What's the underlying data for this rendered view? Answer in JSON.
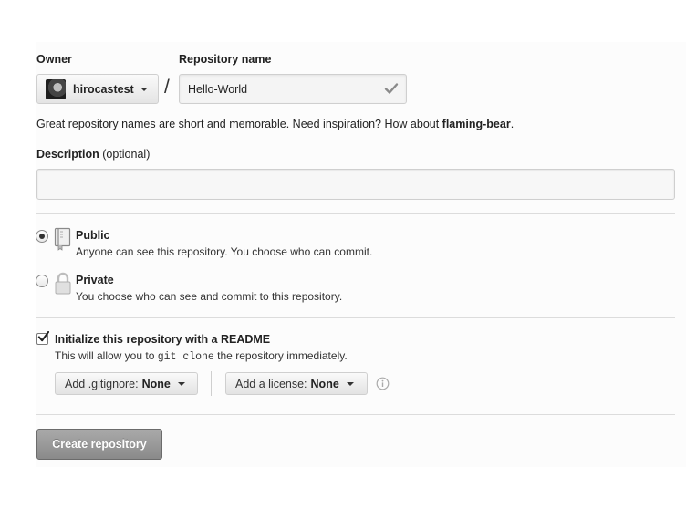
{
  "owner": {
    "label": "Owner",
    "name": "hirocastest"
  },
  "repository": {
    "label": "Repository name",
    "value": "Hello-World",
    "separator": "/"
  },
  "hint": {
    "text": "Great repository names are short and memorable. Need inspiration? How about ",
    "suggestion": "flaming-bear",
    "suffix": "."
  },
  "description": {
    "label": "Description",
    "optional": " (optional)",
    "value": ""
  },
  "visibility": {
    "selected": "Public",
    "public": {
      "title": "Public",
      "desc": "Anyone can see this repository. You choose who can commit."
    },
    "private": {
      "title": "Private",
      "desc": "You choose who can see and commit to this repository."
    }
  },
  "init": {
    "checked": true,
    "title": "Initialize this repository with a README",
    "desc_before": "This will allow you to ",
    "desc_code": "git clone",
    "desc_after": " the repository immediately."
  },
  "gitignore": {
    "label": "Add .gitignore:",
    "value": "None"
  },
  "license": {
    "label": "Add a license:",
    "value": "None"
  },
  "create_button": "Create repository",
  "icons": {
    "check": "check-icon",
    "public_repo": "book-icon",
    "private_repo": "lock-icon",
    "info": "info-icon",
    "caret": "chevron-down-icon"
  },
  "colors": {
    "create_button_bg": "#999999",
    "check": "#8a8a8a"
  }
}
